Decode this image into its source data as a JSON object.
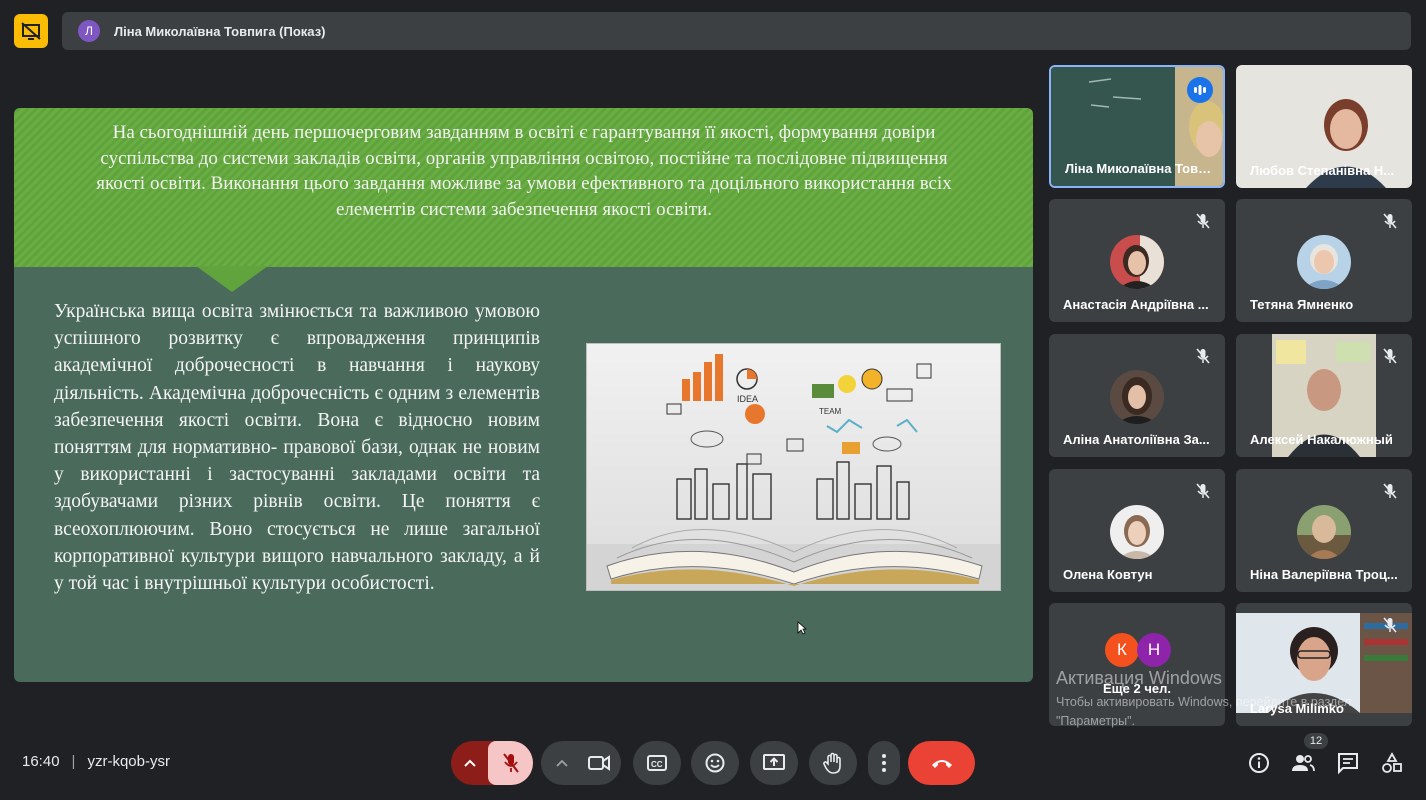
{
  "header": {
    "presenter_initial": "Л",
    "presenter_label": "Ліна Миколаївна Товпига (Показ)"
  },
  "slide": {
    "banner_text": "На сьогоднішній день першочерговим завданням в освіті є гарантування її якості, формування довіри суспільства до системи закладів освіти, органів управління освітою, постійне та послідовне підвищення якості освіти. Виконання цього завдання можливе за умови ефективного та доцільного використання всіх елементів системи забезпечення якості освіти.",
    "body_text": "Українська вища освіта змінюється та важливою умовою успішного розвитку є впровадження принципів академічної доброчесності в навчання і наукову діяльність. Академічна доброчесність є одним з елементів забезпечення якості освіти. Вона є відносно новим поняттям для нормативно- правової бази, однак не новим у використанні і застосуванні закладами освіти та здобувачами різних рівнів освіти. Це поняття є всеохоплюючим. Воно стосується не лише загальної корпоративної культури вищого навчального закладу, а й у той час і внутрішньої культури особистості.",
    "image_icon": "book-city-illustration"
  },
  "participants": [
    {
      "name": "Ліна Миколаївна Товпига",
      "status": "speaking"
    },
    {
      "name": "Любов Степанівна Н..."
    },
    {
      "name": "Анастасія Андріївна ...",
      "status": "muted"
    },
    {
      "name": "Тетяна Ямненко",
      "status": "muted"
    },
    {
      "name": "Аліна Анатоліївна За...",
      "status": "muted"
    },
    {
      "name": "Алексей Накалюжный",
      "status": "muted"
    },
    {
      "name": "Олена Ковтун",
      "status": "muted"
    },
    {
      "name": "Ніна Валеріївна Троц...",
      "status": "muted"
    },
    {
      "name": "Larysa Milimko",
      "status": "muted"
    }
  ],
  "more_tile": {
    "initials": [
      "К",
      "Н"
    ],
    "label": "Еще 2 чел."
  },
  "watermark": {
    "title": "Активация Windows",
    "subtitle": "Чтобы активировать Windows, перейдите в раздел \"Параметры\"."
  },
  "footer": {
    "time": "16:40",
    "meeting_code": "yzr-kqob-ysr",
    "participant_count": "12"
  },
  "colors": {
    "accent_yellow": "#fbbc04",
    "end_call_red": "#ea4335",
    "mic_off_bg": "#f6c6c6",
    "speaking_blue": "#1a73e8"
  }
}
